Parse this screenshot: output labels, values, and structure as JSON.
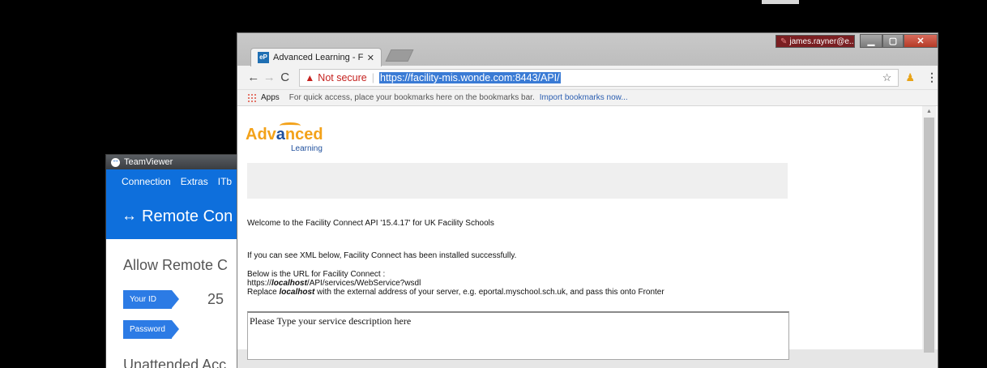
{
  "teamviewer": {
    "title": "TeamViewer",
    "menu": [
      "Connection",
      "Extras",
      "ITb"
    ],
    "header": "Remote Con",
    "allow_heading": "Allow Remote C",
    "your_id_label": "Your ID",
    "your_id_value": "25",
    "password_label": "Password",
    "unattended_heading": "Unattended Acc"
  },
  "chrome": {
    "tab_title": "Advanced Learning - Fac",
    "tab_favicon_text": "eP",
    "profile_name": "james.rayner@e...",
    "security_label": "Not secure",
    "url": "https://facility-mis.wonde.com:8443/API/",
    "bookmarks": {
      "apps_label": "Apps",
      "hint": "For quick access, place your bookmarks here on the bookmarks bar.",
      "import_link": "Import bookmarks now..."
    }
  },
  "page": {
    "logo": {
      "text_orange": "Adv",
      "text_blue": "a",
      "text_orange2": "nced",
      "sub": "Learning"
    },
    "welcome": "Welcome to the Facility Connect API '15.4.17' for UK Facility Schools",
    "xml_note": "If you can see XML below, Facility Connect has been installed successfully.",
    "url_heading": "Below is the URL for Facility Connect :",
    "url_prefix": "https://",
    "url_host": "localhost",
    "url_path": "/API/services/WebService?wsdl",
    "replace_prefix": "Replace ",
    "replace_bold": "localhost",
    "replace_rest": " with the external address of your server, e.g. eportal.myschool.sch.uk, and pass this onto Fronter",
    "service_description": "Please Type your service description here"
  }
}
